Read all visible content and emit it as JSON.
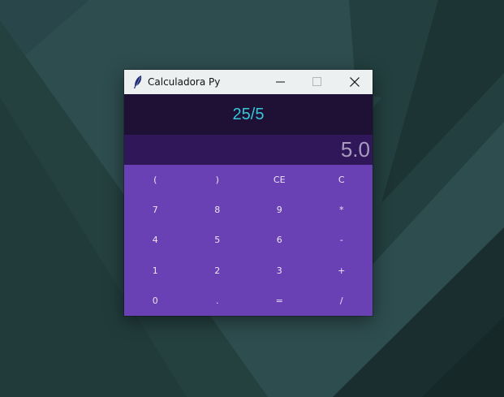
{
  "window": {
    "title": "Calculadora Py",
    "app_icon": "feather-icon",
    "controls": [
      "minimize-icon",
      "maximize-icon",
      "close-icon"
    ]
  },
  "display": {
    "expression": "25/5",
    "result": "5.0"
  },
  "keypad": {
    "rows": [
      [
        "(",
        ")",
        "CE",
        "C"
      ],
      [
        "7",
        "8",
        "9",
        "*"
      ],
      [
        "4",
        "5",
        "6",
        "-"
      ],
      [
        "1",
        "2",
        "3",
        "+"
      ],
      [
        "0",
        ".",
        "=",
        "/"
      ]
    ]
  },
  "colors": {
    "desktop": "#2e4d4f",
    "titlebar": "#ecf0f1",
    "expression_bg": "#1f1135",
    "expression_text": "#38c6d6",
    "result_bg": "#30175a",
    "result_text": "#a99bbf",
    "keypad_bg": "#6a40b5",
    "key_text": "#ece6f5"
  }
}
